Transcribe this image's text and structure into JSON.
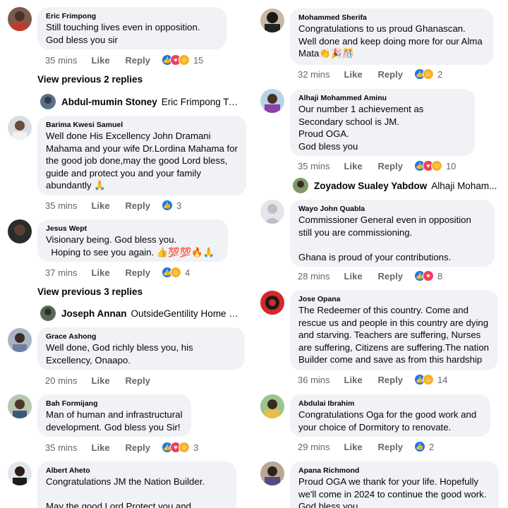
{
  "left": {
    "c1": {
      "author": "Eric Frimpong",
      "text": "Still touching lives even in opposition. God bless you sir",
      "time": "35 mins",
      "like": "Like",
      "reply": "Reply",
      "count": "15"
    },
    "view1": "View previous 2 replies",
    "preview1": {
      "name": "Abdul-mumin Stoney",
      "text": "Eric Frimpong Twe..."
    },
    "c2": {
      "author": "Barima Kwesi Samuel",
      "text": "Well done His Excellency John Dramani Mahama and your wife Dr.Lordina Mahama for the good job done,may the good Lord bless, guide and protect you and your family abundantly 🙏",
      "time": "35 mins",
      "like": "Like",
      "reply": "Reply",
      "count": "3"
    },
    "c3": {
      "author": "Jesus Wept",
      "text": "Visionary being. God bless you.\n  Hoping to see you again. 👍💯💯🔥🙏",
      "time": "37 mins",
      "like": "Like",
      "reply": "Reply",
      "count": "4"
    },
    "view2": "View previous 3 replies",
    "preview2": {
      "name": "Joseph Annan",
      "text": "OutsideGentility Home Cry..."
    },
    "c4": {
      "author": "Grace Ashong",
      "text": "Well done, God richly bless you, his Excellency, Onaapo.",
      "time": "20 mins",
      "like": "Like",
      "reply": "Reply"
    },
    "c5": {
      "author": "Bah Formijang",
      "text": "Man of human and infrastructural development. God bless you Sir!",
      "time": "35 mins",
      "like": "Like",
      "reply": "Reply",
      "count": "3"
    },
    "c6": {
      "author": "Albert Aheto",
      "text": "Congratulations JM the Nation Builder.\n\nMay the good Lord Protect you and increase"
    }
  },
  "right": {
    "c1": {
      "author": "Mohammed Sherifa",
      "text": "Congratulations to us proud Ghanascan. Well done and keep doing more for our Alma Mata👏🎉🎊",
      "time": "32 mins",
      "like": "Like",
      "reply": "Reply",
      "count": "2"
    },
    "c2": {
      "author": "Alhaji Mohammed Aminu",
      "text": "Our number 1 achievement as Secondary school is JM.\nProud OGA.\nGod bless you",
      "time": "35 mins",
      "like": "Like",
      "reply": "Reply",
      "count": "10"
    },
    "preview1": {
      "name": "Zoyadow Sualey Yabdow",
      "text": "Alhaji Moham..."
    },
    "c3": {
      "author": "Wayo John Quabla",
      "text": "Commissioner General even in opposition still you are commissioning.\n\nGhana is proud of your contributions.",
      "time": "28 mins",
      "like": "Like",
      "reply": "Reply",
      "count": "8"
    },
    "c4": {
      "author": "Jose Opana",
      "text": "The Redeemer of this country. Come and rescue us and people in this country are dying and starving. Teachers are suffering, Nurses are suffering, Citizens are suffering.The nation Builder come and save as from this hardship",
      "time": "36 mins",
      "like": "Like",
      "reply": "Reply",
      "count": "14"
    },
    "c5": {
      "author": "Abdulai Ibrahim",
      "text": "Congratulations Oga for the good work and your choice of Dormitory to renovate.",
      "time": "29 mins",
      "like": "Like",
      "reply": "Reply",
      "count": "2"
    },
    "c6": {
      "author": "Apana Richmond",
      "text": "Proud OGA we thank for your life. Hopefully we'll come in 2024 to continue the good work.\nGod bless you"
    }
  },
  "icons": {
    "like": "like-reaction-icon",
    "love": "love-reaction-icon",
    "haha": "haha-reaction-icon"
  },
  "colors": {
    "bubble": "#f0f2f5",
    "like": "#1877f2",
    "love": "#f33e58",
    "haha": "#f7b125",
    "meta": "#65676b"
  }
}
